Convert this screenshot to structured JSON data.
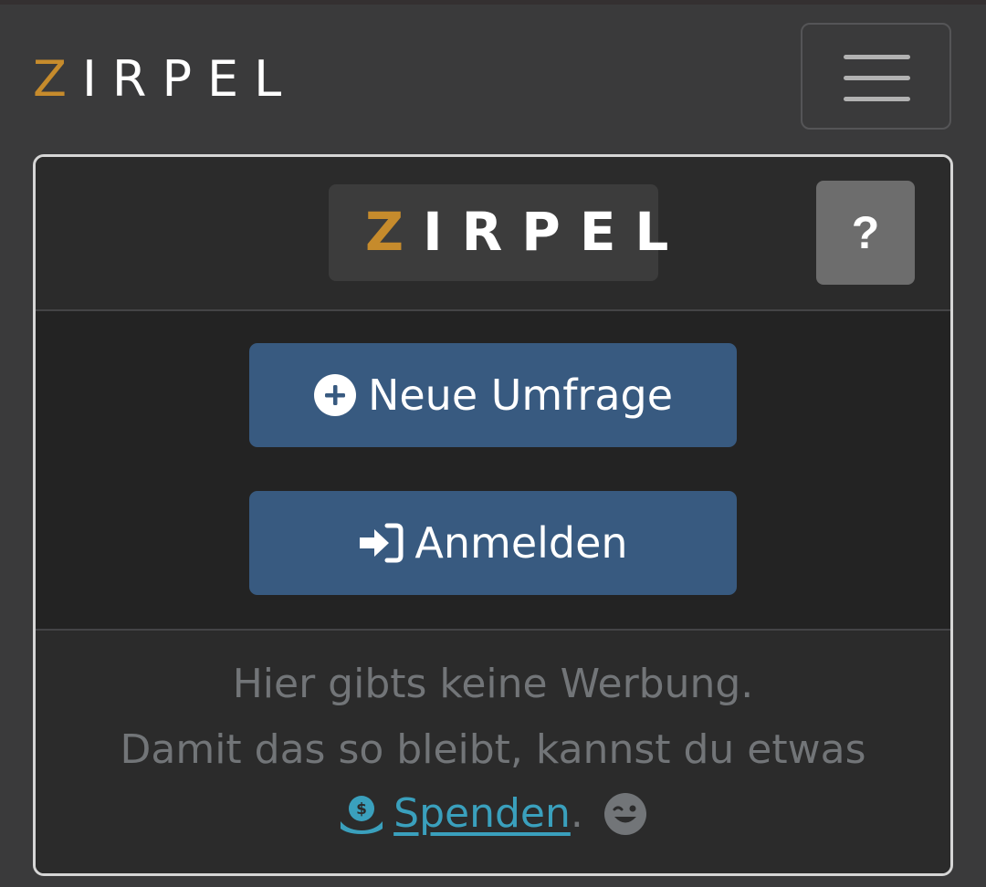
{
  "navbar": {
    "brand_z": "Z",
    "brand_rest": "IRPEL",
    "menu_icon": "hamburger-menu-icon"
  },
  "card": {
    "header": {
      "logo_z": "Z",
      "logo_rest": "IRPEL",
      "help_label": "?"
    },
    "buttons": {
      "new_poll_label": "Neue Umfrage",
      "new_poll_icon": "plus-circle-icon",
      "login_label": "Anmelden",
      "login_icon": "sign-in-icon"
    },
    "footer": {
      "line1": "Hier gibts keine Werbung.",
      "line2": "Damit das so bleibt, kannst du etwas",
      "donate_label": "Spenden",
      "donate_icon": "hand-holding-dollar-icon",
      "period": ".",
      "wink_icon": "wink-emoji-icon"
    }
  },
  "colors": {
    "accent": "#c68b2c",
    "button": "#385a80",
    "link": "#3aa0bd",
    "muted_text": "#727578"
  }
}
